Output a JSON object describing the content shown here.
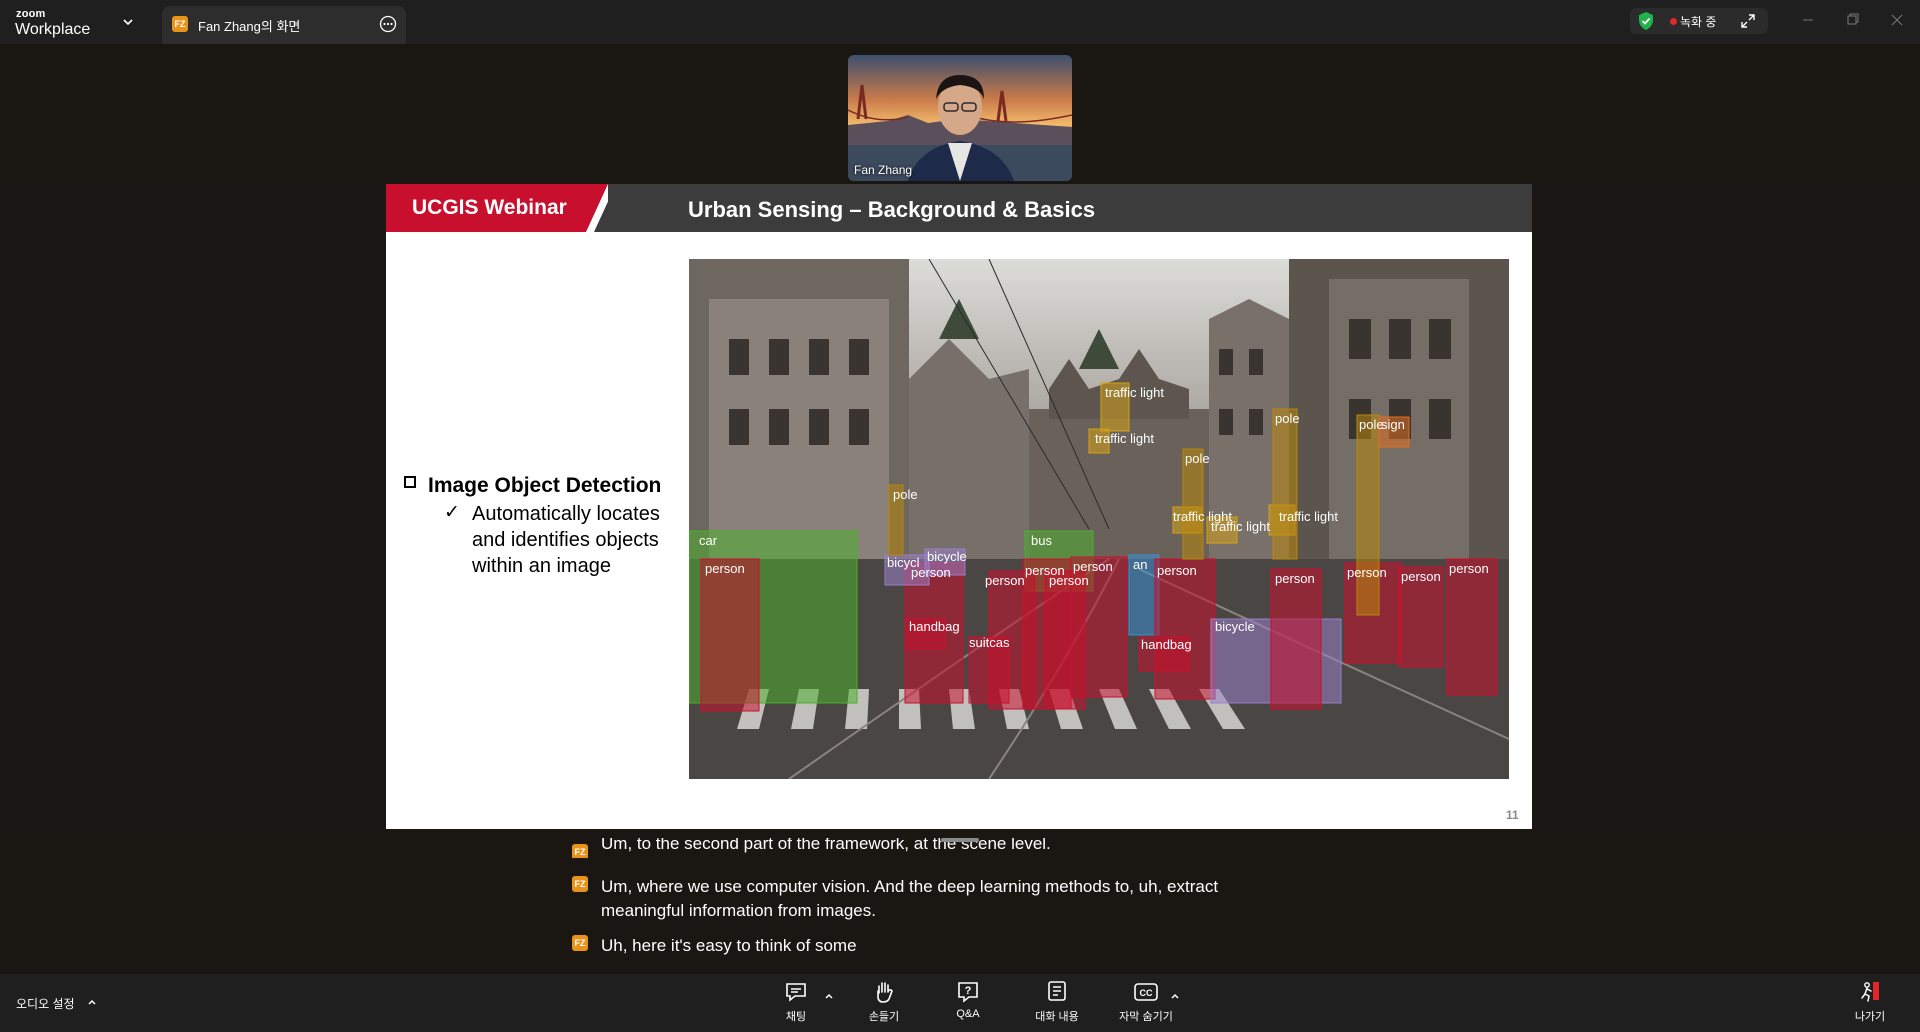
{
  "titlebar": {
    "brand_top": "zoom",
    "brand_name": "Workplace",
    "tab_badge": "FZ",
    "tab_title": "Fan Zhang의 화면",
    "recording_label": "녹화 중"
  },
  "video": {
    "participant_name": "Fan Zhang"
  },
  "slide": {
    "brand": "UCGIS Webinar",
    "title": "Urban Sensing – Background & Basics",
    "bullet_heading": "Image Object Detection",
    "bullet_body": "Automatically locates and identifies objects within an image",
    "page_number": "11",
    "detections": [
      {
        "label": "car",
        "color": "#4caf2e"
      },
      {
        "label": "person",
        "color": "#c8102e"
      },
      {
        "label": "person",
        "color": "#c8102e"
      },
      {
        "label": "person",
        "color": "#c8102e"
      },
      {
        "label": "person",
        "color": "#c8102e"
      },
      {
        "label": "person",
        "color": "#c8102e"
      },
      {
        "label": "person",
        "color": "#c8102e"
      },
      {
        "label": "person",
        "color": "#c8102e"
      },
      {
        "label": "person",
        "color": "#c8102e"
      },
      {
        "label": "person",
        "color": "#c8102e"
      },
      {
        "label": "person",
        "color": "#c8102e"
      },
      {
        "label": "person",
        "color": "#c8102e"
      },
      {
        "label": "bus",
        "color": "#4caf2e"
      },
      {
        "label": "traffic light",
        "color": "#d4a017"
      },
      {
        "label": "traffic light",
        "color": "#d4a017"
      },
      {
        "label": "traffic light",
        "color": "#d4a017"
      },
      {
        "label": "traffic light",
        "color": "#d4a017"
      },
      {
        "label": "traffic light",
        "color": "#d4a017"
      },
      {
        "label": "pole",
        "color": "#b8860b"
      },
      {
        "label": "pole",
        "color": "#b8860b"
      },
      {
        "label": "pole",
        "color": "#b8860b"
      },
      {
        "label": "pole",
        "color": "#b8860b"
      },
      {
        "label": "sign",
        "color": "#e07020"
      },
      {
        "label": "handbag",
        "color": "#c8102e"
      },
      {
        "label": "handbag",
        "color": "#c8102e"
      },
      {
        "label": "suitcase",
        "color": "#c8102e"
      },
      {
        "label": "bicycle",
        "color": "#9b7fc8"
      },
      {
        "label": "bicycle",
        "color": "#9b7fc8"
      },
      {
        "label": "bicycle",
        "color": "#9b7fc8"
      },
      {
        "label": "an",
        "color": "#3a8fd0"
      }
    ]
  },
  "captions": [
    {
      "badge": "FZ",
      "text": "Um, to the second part of the framework, at the scene level."
    },
    {
      "badge": "FZ",
      "text": "Um, where we use computer vision. And the deep learning methods to, uh, extract meaningful information from images."
    },
    {
      "badge": "FZ",
      "text": "Uh, here it's easy to think of some"
    }
  ],
  "toolbar": {
    "audio_settings": "오디오 설정",
    "chat": "채팅",
    "raise_hand": "손들기",
    "qa": "Q&A",
    "transcript": "대화 내용",
    "hide_captions": "자막 숨기기",
    "leave": "나가기"
  },
  "colors": {
    "accent_red": "#c8102e",
    "badge_orange": "#e8941a",
    "shield_green": "#21b24b",
    "leave_red": "#e02828"
  }
}
